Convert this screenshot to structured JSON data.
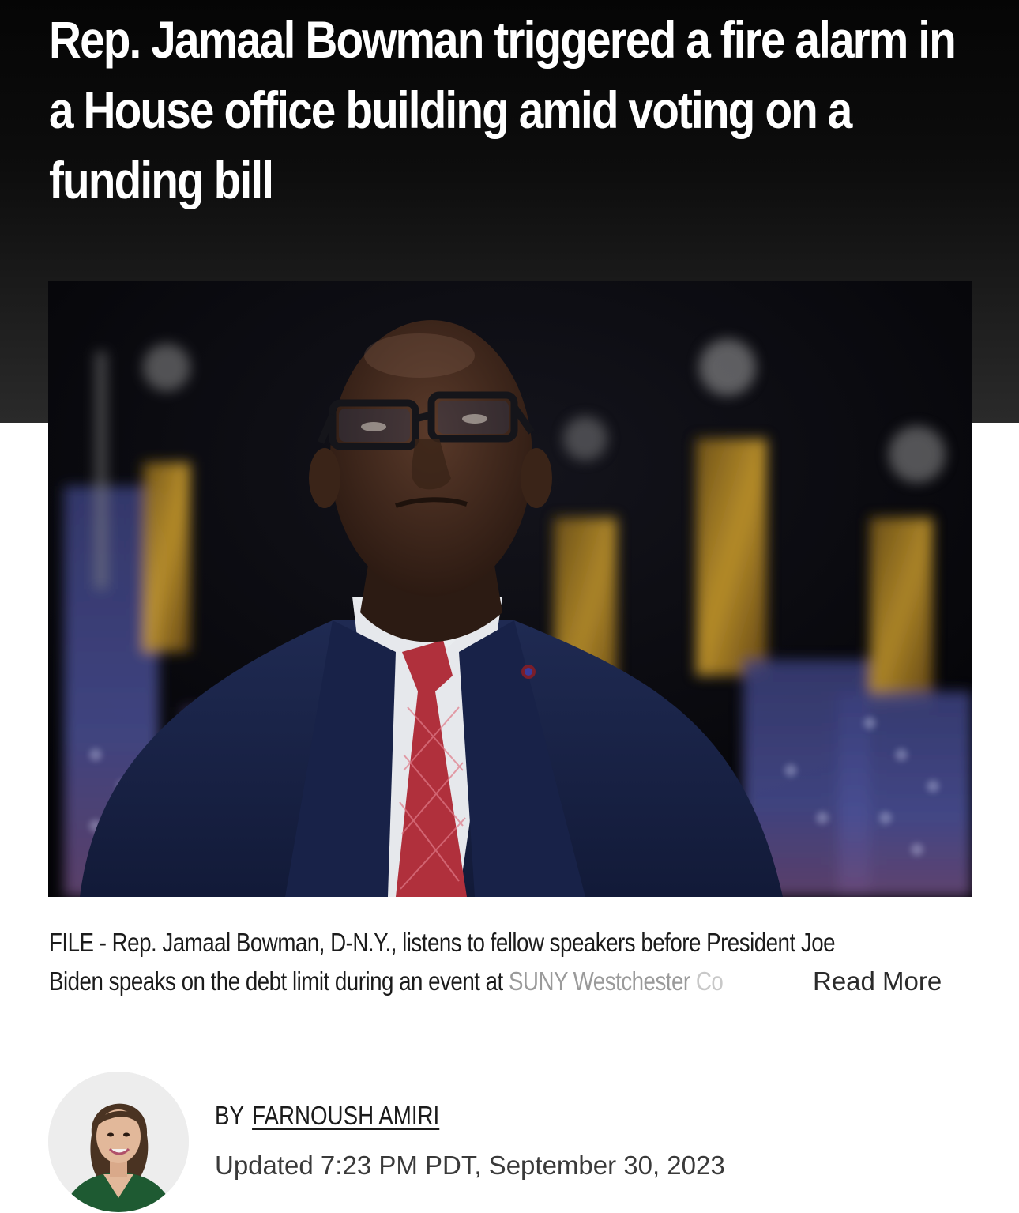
{
  "article": {
    "headline": "Rep. Jamaal Bowman triggered a fire alarm in a House office building amid voting on a funding bill",
    "photo": {
      "subject": "photo-of-man-in-suit-with-flags"
    },
    "caption": {
      "line1": "FILE - Rep. Jamaal Bowman, D-N.Y., listens to fellow speakers before President Joe",
      "line2_start": "Biden speaks on the debt limit during an event at ",
      "line2_fade": "SUNY Westchester ",
      "line2_fade2": "Co",
      "read_more": "Read More"
    },
    "byline": {
      "prefix": "BY",
      "author": "FARNOUSH AMIRI"
    },
    "timestamp": "Updated 7:23 PM PDT, September 30, 2023"
  },
  "colors": {
    "header_bg": "#050505",
    "headline_text": "#ffffff",
    "body_text": "#1b1b1b"
  }
}
